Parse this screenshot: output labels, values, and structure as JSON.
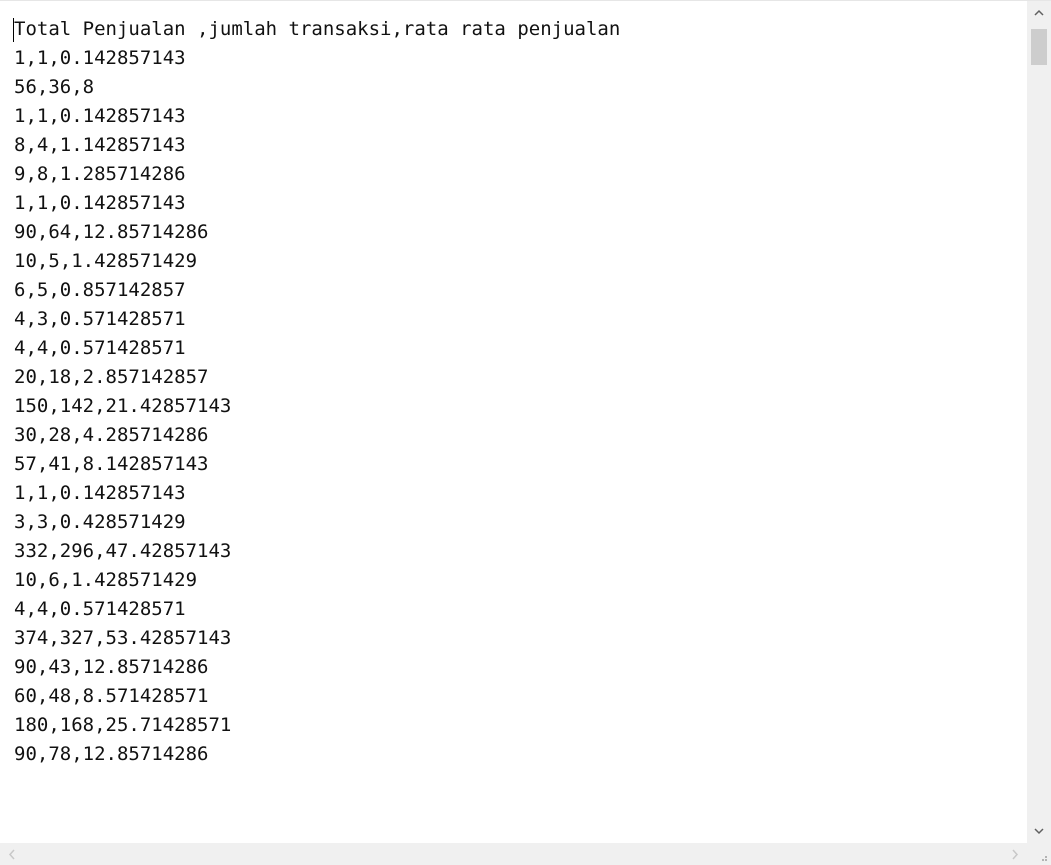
{
  "document": {
    "lines": [
      "Total Penjualan ,jumlah transaksi,rata rata penjualan",
      "1,1,0.142857143",
      "56,36,8",
      "1,1,0.142857143",
      "8,4,1.142857143",
      "9,8,1.285714286",
      "1,1,0.142857143",
      "90,64,12.85714286",
      "10,5,1.428571429",
      "6,5,0.857142857",
      "4,3,0.571428571",
      "4,4,0.571428571",
      "20,18,2.857142857",
      "150,142,21.42857143",
      "30,28,4.285714286",
      "57,41,8.142857143",
      "1,1,0.142857143",
      "3,3,0.428571429",
      "332,296,47.42857143",
      "10,6,1.428571429",
      "4,4,0.571428571",
      "374,327,53.42857143",
      "90,43,12.85714286",
      "60,48,8.571428571",
      "180,168,25.71428571",
      "90,78,12.85714286"
    ]
  },
  "icons": {
    "scroll_up": "chevron-up-icon",
    "scroll_down": "chevron-down-icon",
    "scroll_left": "chevron-left-icon",
    "scroll_right": "chevron-right-icon",
    "resize_grip": "resize-grip-icon"
  },
  "colors": {
    "text": "#111111",
    "background": "#ffffff",
    "scrollbar_track": "#f0f0f0",
    "scrollbar_thumb": "#cdcdcd",
    "arrow_enabled": "#606060",
    "arrow_disabled": "#c8c8c8"
  }
}
